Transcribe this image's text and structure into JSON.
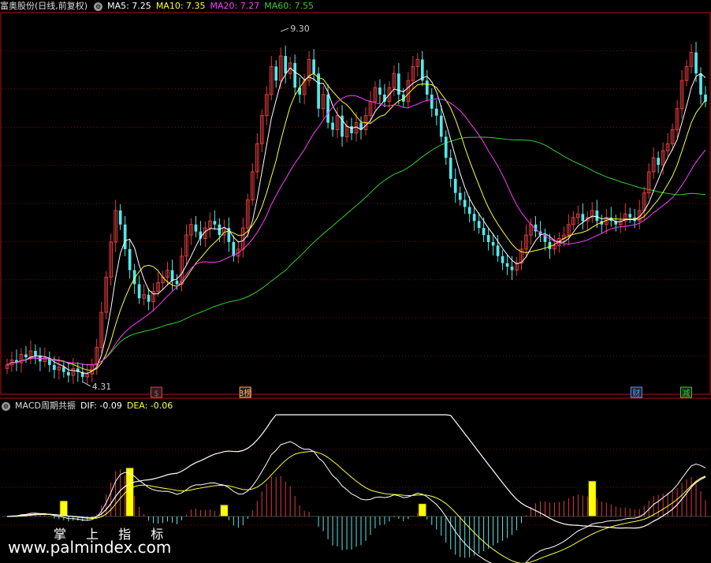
{
  "colors": {
    "up": "#e03b3b",
    "down": "#55e8e8",
    "ma5": "#ffffff",
    "ma10": "#ffff33",
    "ma20": "#ff3cff",
    "ma60": "#33cc33",
    "grid": "#7a0c0c",
    "frame": "#b01515",
    "dif": "#ffffff",
    "dea": "#ffff44",
    "bar_yellow": "#ffff00"
  },
  "top_header": {
    "stock": "富奥股份(日线,前复权)",
    "ma5": "MA5: 7.25",
    "ma10": "MA10: 7.35",
    "ma20": "MA20: 7.27",
    "ma60": "MA60: 7.55"
  },
  "bottom_header": {
    "indicator": "MACD周期共振",
    "dif": "DIF: -0.09",
    "dea": "DEA: -0.06"
  },
  "markers": [
    {
      "label": "$",
      "color": "#e03b3b"
    },
    {
      "label": "3榜",
      "color": "#ffaa66"
    },
    {
      "label": "财",
      "color": "#5599ff"
    },
    {
      "label": "减",
      "color": "#33cc33"
    }
  ],
  "watermark": {
    "cn": "掌 上 指 标",
    "url": "www.palmindex.com"
  },
  "chart_data": [
    {
      "type": "candlestick",
      "title": "富奥股份(日线,前复权)",
      "ylim": [
        4.2,
        9.5
      ],
      "annotations": [
        {
          "label": "9.30",
          "value": 9.3
        },
        {
          "label": "4.31",
          "value": 4.31
        }
      ],
      "series": [
        {
          "name": "MA5",
          "value": 7.25
        },
        {
          "name": "MA10",
          "value": 7.35
        },
        {
          "name": "MA20",
          "value": 7.27
        },
        {
          "name": "MA60",
          "value": 7.55
        }
      ],
      "closes": [
        4.55,
        4.62,
        4.58,
        4.7,
        4.66,
        4.75,
        4.68,
        4.6,
        4.65,
        4.55,
        4.48,
        4.52,
        4.45,
        4.4,
        4.5,
        4.45,
        4.38,
        4.42,
        4.55,
        4.8,
        5.3,
        5.8,
        6.3,
        6.75,
        6.55,
        6.2,
        5.9,
        5.7,
        5.5,
        5.55,
        5.45,
        5.6,
        5.72,
        5.8,
        5.9,
        5.75,
        5.7,
        6.1,
        6.4,
        6.55,
        6.45,
        6.35,
        6.5,
        6.6,
        6.55,
        6.4,
        6.5,
        6.3,
        6.1,
        6.2,
        6.5,
        6.9,
        7.3,
        7.7,
        8.1,
        8.4,
        8.8,
        8.6,
        8.95,
        8.7,
        8.85,
        8.5,
        8.4,
        8.6,
        8.9,
        8.7,
        8.2,
        8.4,
        8.0,
        7.9,
        8.1,
        7.8,
        7.95,
        7.85,
        8.0,
        7.9,
        8.1,
        8.3,
        8.5,
        8.4,
        8.3,
        8.5,
        8.7,
        8.4,
        8.3,
        8.6,
        8.8,
        8.9,
        8.6,
        8.4,
        8.2,
        8.1,
        7.8,
        7.5,
        7.2,
        7.0,
        6.9,
        6.8,
        6.7,
        6.6,
        6.5,
        6.4,
        6.3,
        6.25,
        6.1,
        6.0,
        5.95,
        5.9,
        6.0,
        6.2,
        6.4,
        6.55,
        6.45,
        6.4,
        6.3,
        6.2,
        6.25,
        6.35,
        6.4,
        6.55,
        6.65,
        6.7,
        6.6,
        6.65,
        6.75,
        6.6,
        6.55,
        6.65,
        6.6,
        6.55,
        6.6,
        6.7,
        6.65,
        6.6,
        6.75,
        7.0,
        7.3,
        7.5,
        7.4,
        7.6,
        7.7,
        7.9,
        8.2,
        8.6,
        8.8,
        9.0,
        8.7,
        8.4,
        8.3
      ]
    },
    {
      "type": "bar",
      "title": "MACD周期共振",
      "series": [
        {
          "name": "DIF",
          "value": -0.09
        },
        {
          "name": "DEA",
          "value": -0.06
        }
      ]
    }
  ]
}
